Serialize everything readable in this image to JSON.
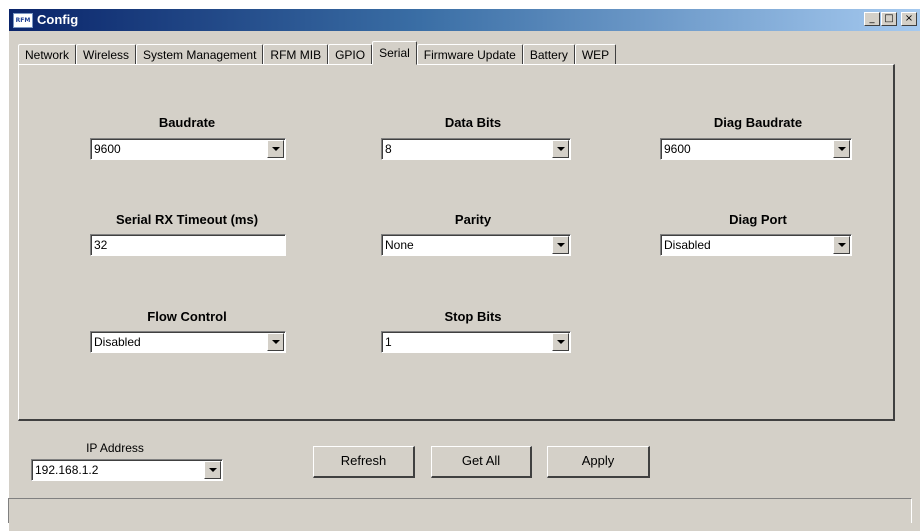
{
  "window": {
    "title": "Config",
    "app_icon_text": "RFM",
    "minimize_glyph": "_",
    "maximize_glyph": "□",
    "close_glyph": "×"
  },
  "tabs": [
    {
      "label": "Network"
    },
    {
      "label": "Wireless"
    },
    {
      "label": "System Management"
    },
    {
      "label": "RFM MIB"
    },
    {
      "label": "GPIO"
    },
    {
      "label": "Serial",
      "active": true
    },
    {
      "label": "Firmware Update"
    },
    {
      "label": "Battery"
    },
    {
      "label": "WEP"
    }
  ],
  "serial": {
    "baudrate": {
      "label": "Baudrate",
      "value": "9600"
    },
    "data_bits": {
      "label": "Data Bits",
      "value": "8"
    },
    "diag_baudrate": {
      "label": "Diag Baudrate",
      "value": "9600"
    },
    "rx_timeout": {
      "label": "Serial RX Timeout (ms)",
      "value": "32"
    },
    "parity": {
      "label": "Parity",
      "value": "None"
    },
    "diag_port": {
      "label": "Diag Port",
      "value": "Disabled"
    },
    "flow_control": {
      "label": "Flow Control",
      "value": "Disabled"
    },
    "stop_bits": {
      "label": "Stop Bits",
      "value": "1"
    }
  },
  "footer": {
    "ip_label": "IP Address",
    "ip_value": "192.168.1.2",
    "refresh_label": "Refresh",
    "get_all_label": "Get All",
    "apply_label": "Apply"
  },
  "colors": {
    "face": "#d4d0c8",
    "title_start": "#0a246a",
    "title_end": "#a6caf0"
  }
}
